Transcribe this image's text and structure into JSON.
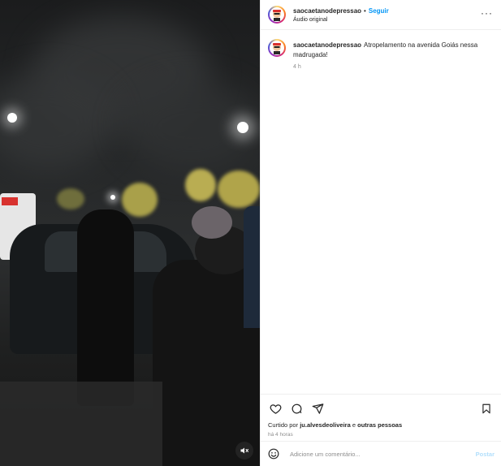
{
  "account": {
    "username": "saocaetanodepressao",
    "follow_label": "Seguir",
    "separator": "•",
    "audio_label": "Áudio original"
  },
  "caption": {
    "username": "saocaetanodepressao",
    "text": "Atropelamento na avenida Goiás nessa madrugada!",
    "time": "4 h"
  },
  "likes": {
    "prefix": "Curtido por",
    "user": "ju.alvesdeoliveira",
    "conjunction": "e",
    "others": "outras pessoas"
  },
  "posted_ago": "há 4 horas",
  "comment_input": {
    "placeholder": "Adicione um comentário...",
    "submit_label": "Postar"
  },
  "icons": {
    "more": "more-options-icon",
    "like": "heart-icon",
    "comment": "comment-icon",
    "share": "share-icon",
    "save": "bookmark-icon",
    "emoji": "emoji-icon",
    "mute": "muted-speaker-icon"
  },
  "colors": {
    "accent": "#0095f6",
    "muted_text": "#8e8e8e",
    "post_disabled": "#b2dffc"
  }
}
